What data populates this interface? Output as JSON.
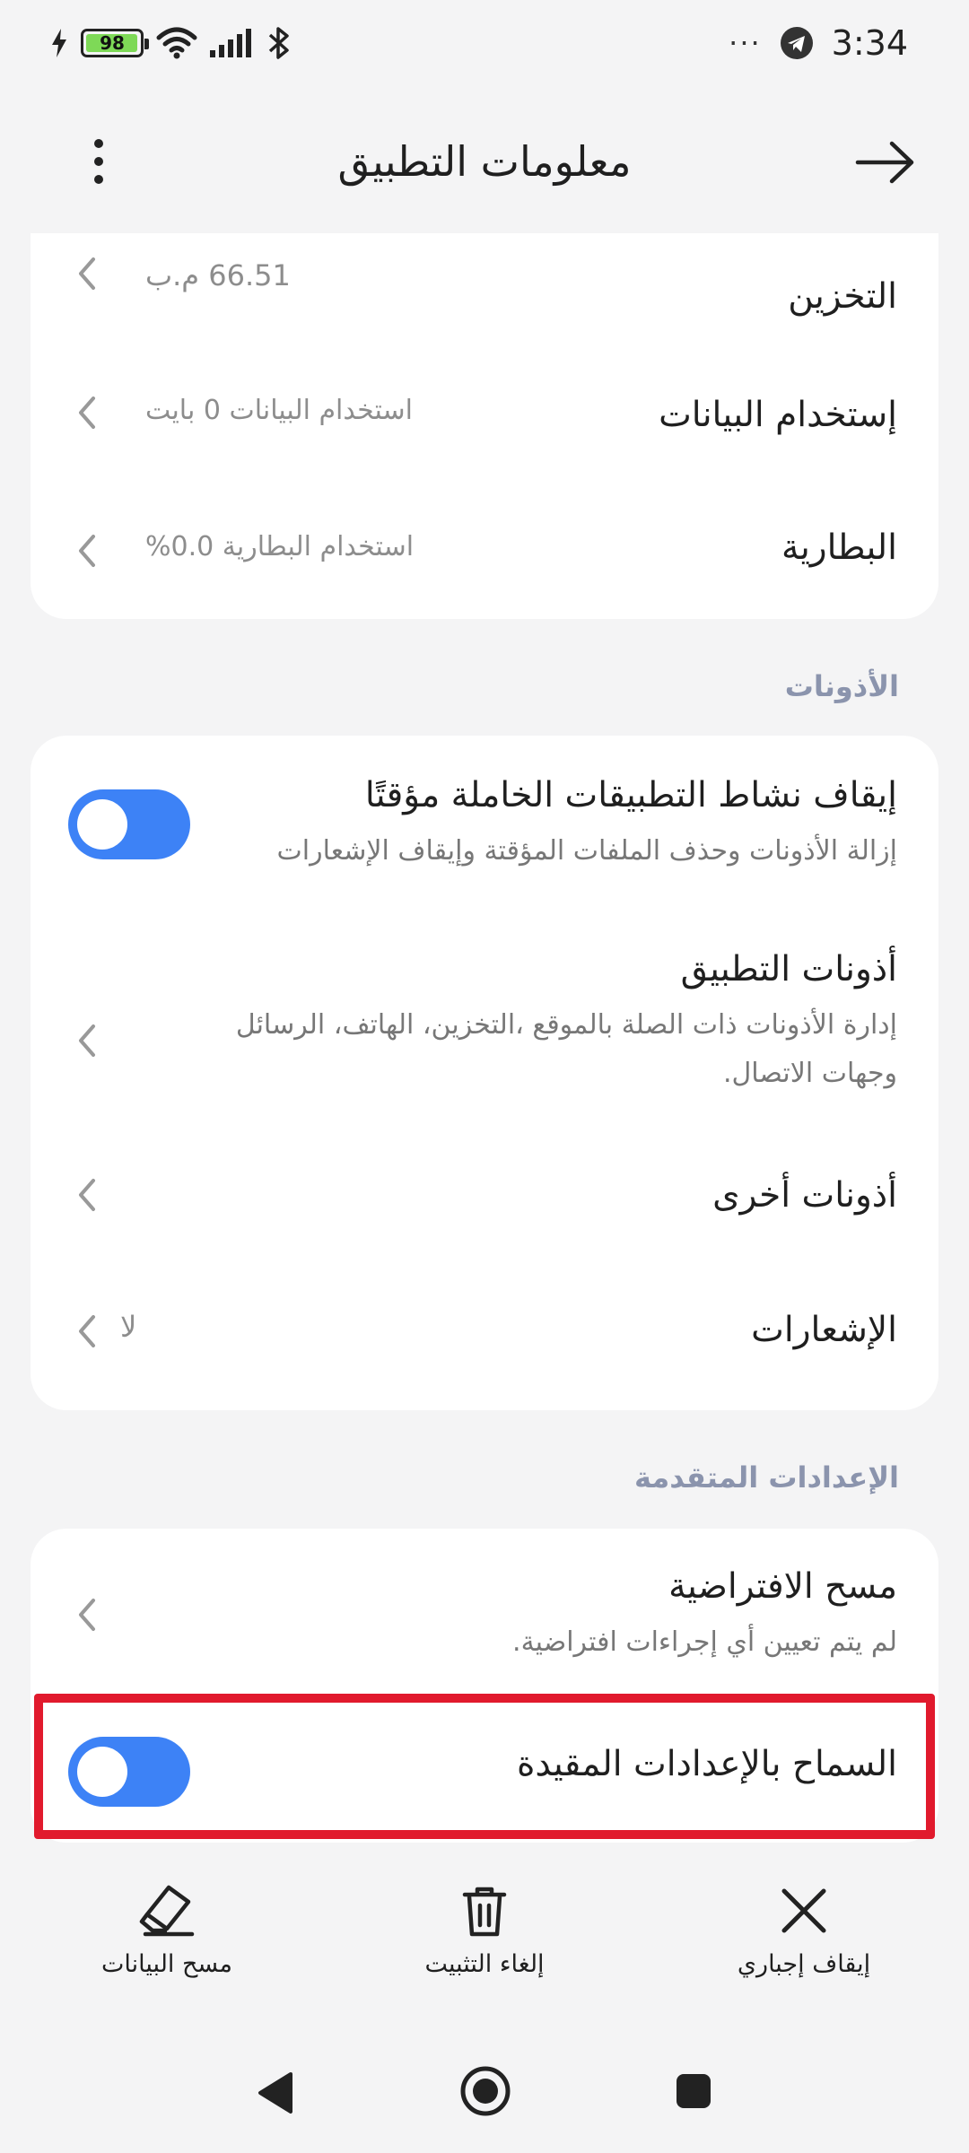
{
  "status_bar": {
    "battery_level": "98",
    "time": "3:34",
    "more_indicator": "···"
  },
  "header": {
    "title": "معلومات التطبيق"
  },
  "info_card": {
    "storage": {
      "title": "التخزين",
      "value": "66.51 م.ب"
    },
    "data_usage": {
      "title": "إستخدام البيانات",
      "value": "استخدام البيانات 0 بايت"
    },
    "battery": {
      "title": "البطارية",
      "value": "استخدام البطارية 0.0%"
    }
  },
  "permissions": {
    "section_label": "الأذونات",
    "pause_activity": {
      "title": "إيقاف نشاط التطبيقات الخاملة مؤقتًا",
      "subtitle": "إزالة الأذونات وحذف الملفات المؤقتة وإيقاف الإشعارات",
      "enabled": true
    },
    "app_permissions": {
      "title": "أذونات التطبيق",
      "subtitle_line1": "إدارة الأذونات ذات الصلة بالموقع ،التخزين، الهاتف، الرسائل",
      "subtitle_line2": "وجهات الاتصال."
    },
    "other_permissions": {
      "title": "أذونات أخرى"
    },
    "notifications": {
      "title": "الإشعارات",
      "value": "لا"
    }
  },
  "advanced": {
    "section_label": "الإعدادات المتقدمة",
    "clear_defaults": {
      "title": "مسح الافتراضية",
      "subtitle": "لم يتم تعيين أي إجراءات افتراضية."
    },
    "allow_restricted": {
      "title": "السماح بالإعدادات المقيدة",
      "enabled": true
    }
  },
  "actions": {
    "force_stop": "إيقاف إجباري",
    "uninstall": "إلغاء التثبيت",
    "clear_data": "مسح البيانات"
  },
  "colors": {
    "accent": "#3d82f6",
    "highlight": "#e11a2d",
    "background": "#f4f4f5"
  }
}
